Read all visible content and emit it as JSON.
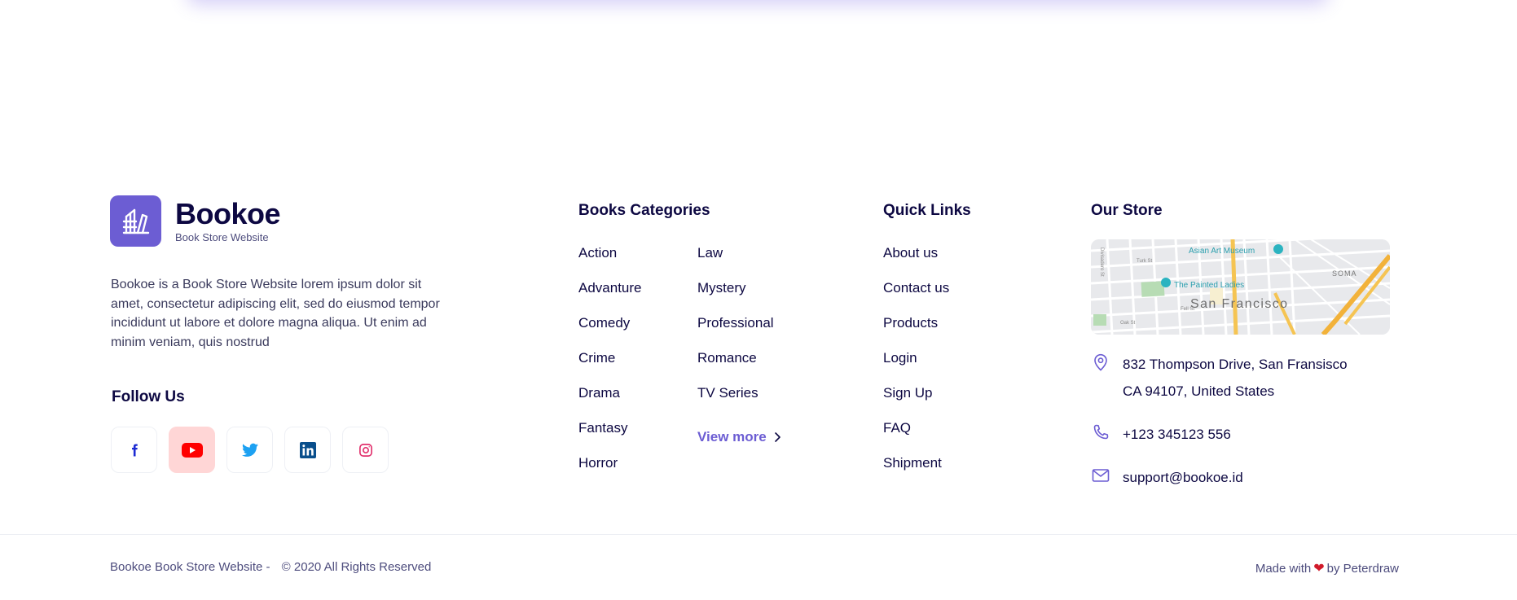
{
  "brand": {
    "name": "Bookoe",
    "tagline": "Book Store Website",
    "description": "Bookoe is a Book Store Website lorem ipsum dolor sit amet, consectetur adipiscing elit, sed do eiusmod tempor incididunt ut labore et dolore magna aliqua. Ut enim ad minim veniam, quis nostrud",
    "accent_color": "#6c5dd3"
  },
  "follow": {
    "title": "Follow Us",
    "networks": [
      {
        "name": "facebook-icon",
        "color": "#1877f2"
      },
      {
        "name": "youtube-icon",
        "color": "#ff0000",
        "active": true
      },
      {
        "name": "twitter-icon",
        "color": "#1da1f2"
      },
      {
        "name": "linkedin-icon",
        "color": "#0a66c2"
      },
      {
        "name": "instagram-icon",
        "color": "#e1306c"
      }
    ]
  },
  "categories": {
    "title": "Books Categories",
    "col1": [
      "Action",
      "Advanture",
      "Comedy",
      "Crime",
      "Drama",
      "Fantasy",
      "Horror"
    ],
    "col2": [
      "Law",
      "Mystery",
      "Professional",
      "Romance",
      "TV Series"
    ],
    "view_more": "View more"
  },
  "quick_links": {
    "title": "Quick Links",
    "items": [
      "About us",
      "Contact us",
      "Products",
      "Login",
      "Sign Up",
      "FAQ",
      "Shipment"
    ]
  },
  "store": {
    "title": "Our Store",
    "map": {
      "city_label": "San Francisco",
      "poi_1": "Asian Art Museum",
      "poi_2": "The Painted Ladies",
      "district": "SOMA",
      "street_1": "Turk St",
      "street_2": "Fell St",
      "street_3": "Oak St",
      "street_4": "Divisadero St"
    },
    "address_line1": "832  Thompson Drive, San Fransisco",
    "address_line2": "CA 94107, United States",
    "phone": "+123 345123 556",
    "email": "support@bookoe.id"
  },
  "footer": {
    "copyright_left": "Bookoe Book Store Website  -",
    "copyright_right": "© 2020 All Rights Reserved",
    "made_with": "Made with",
    "heart": "❤",
    "by": "by Peterdraw"
  }
}
